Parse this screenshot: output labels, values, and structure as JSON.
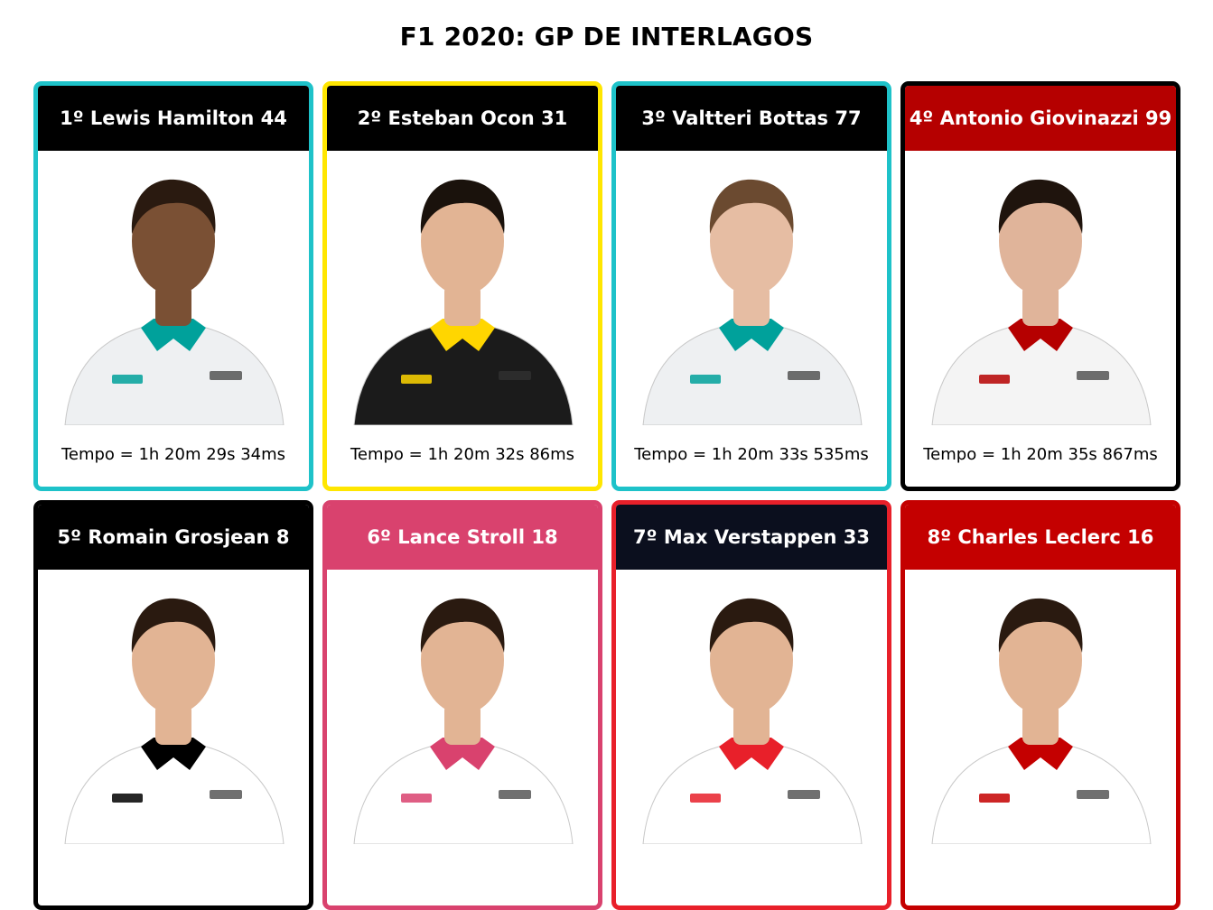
{
  "title": "F1 2020: GP DE INTERLAGOS",
  "drivers": [
    {
      "header": "1º Lewis Hamilton 44",
      "tempo": "Tempo = 1h 20m 29s 34ms",
      "border": "#1ec2c9",
      "header_bg": "#000000",
      "suit": "#eef0f2",
      "skin": "#7a5034",
      "hair": "#2a1a10",
      "accent": "#00a19b"
    },
    {
      "header": "2º Esteban Ocon 31",
      "tempo": "Tempo = 1h 20m 32s 86ms",
      "border": "#ffe600",
      "header_bg": "#000000",
      "suit": "#1b1b1b",
      "skin": "#e2b494",
      "hair": "#1a120c",
      "accent": "#ffd600"
    },
    {
      "header": "3º Valtteri Bottas 77",
      "tempo": "Tempo = 1h 20m 33s 535ms",
      "border": "#1ec2c9",
      "header_bg": "#000000",
      "suit": "#eef0f2",
      "skin": "#e6bda3",
      "hair": "#6b4a30",
      "accent": "#00a19b"
    },
    {
      "header": "4º Antonio Giovinazzi 99",
      "tempo": "Tempo = 1h 20m 35s 867ms",
      "border": "#000000",
      "header_bg": "#b50000",
      "suit": "#f4f4f4",
      "skin": "#e0b49a",
      "hair": "#1f140d",
      "accent": "#b50000"
    },
    {
      "header": "5º Romain Grosjean 8",
      "tempo": "",
      "border": "#000000",
      "header_bg": "#000000",
      "suit": "#ffffff",
      "skin": "#e2b494",
      "hair": "#2a1a10",
      "accent": "#000000"
    },
    {
      "header": "6º Lance Stroll 18",
      "tempo": "",
      "border": "#d9426e",
      "header_bg": "#d9426e",
      "suit": "#ffffff",
      "skin": "#e2b494",
      "hair": "#2a1a10",
      "accent": "#d9426e"
    },
    {
      "header": "7º Max Verstappen 33",
      "tempo": "",
      "border": "#e8202a",
      "header_bg": "#0b0f1e",
      "suit": "#ffffff",
      "skin": "#e2b494",
      "hair": "#2a1a10",
      "accent": "#e8202a"
    },
    {
      "header": "8º Charles Leclerc 16",
      "tempo": "",
      "border": "#c40000",
      "header_bg": "#c40000",
      "suit": "#ffffff",
      "skin": "#e2b494",
      "hair": "#2a1a10",
      "accent": "#c40000"
    }
  ]
}
